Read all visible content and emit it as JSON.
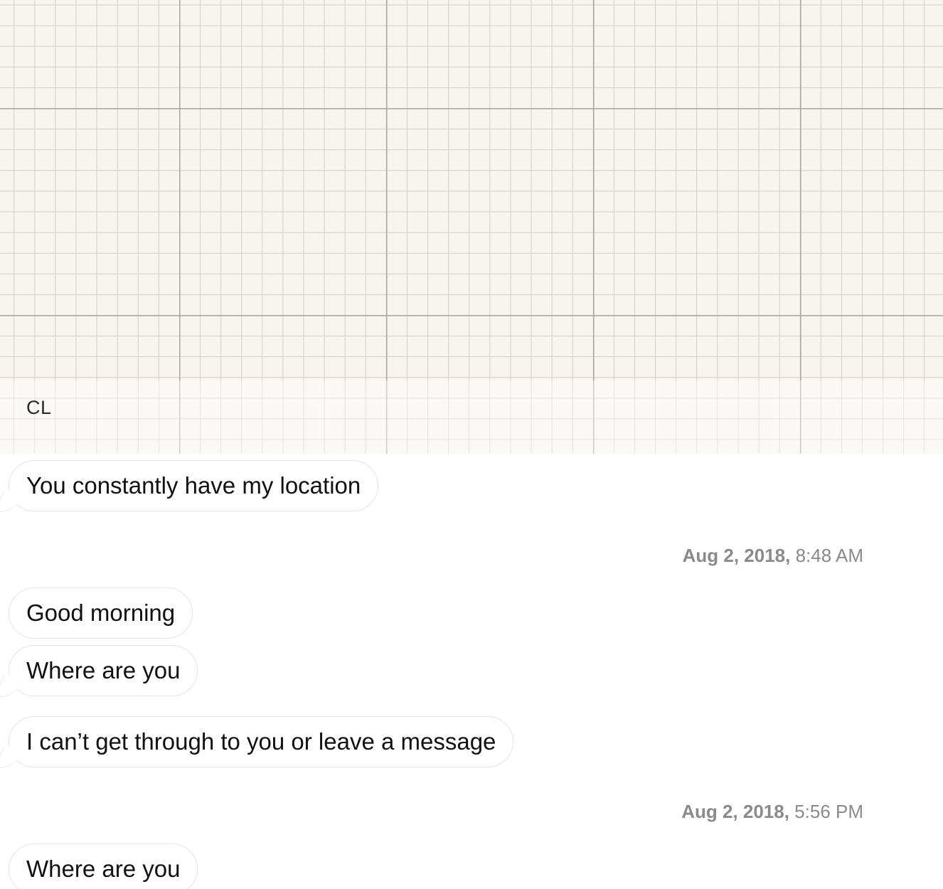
{
  "header": {
    "contact_initials": "CL"
  },
  "messages": [
    {
      "text": "You constantly have my location"
    },
    {
      "text": "Good morning"
    },
    {
      "text": "Where are you"
    },
    {
      "text": "I can’t get through to you or leave a message"
    },
    {
      "text": "Where are you"
    }
  ],
  "timestamps": [
    {
      "date": "Aug 2, 2018,",
      "time": "8:48 AM"
    },
    {
      "date": "Aug 2, 2018,",
      "time": "5:56 PM"
    }
  ],
  "colors": {
    "grid_background": "#f8f4ee",
    "grid_major": "#a9a49c",
    "grid_minor": "#d3cdc4",
    "bubble_background": "#ffffff",
    "bubble_border": "#e4e4e4",
    "timestamp_text": "#8a8a8a"
  }
}
